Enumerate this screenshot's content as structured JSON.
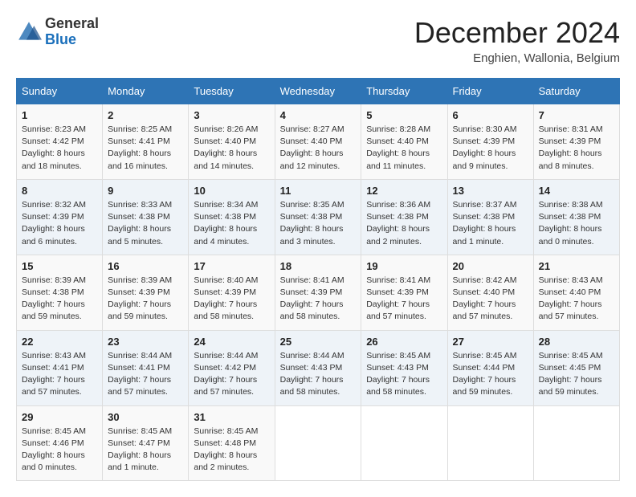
{
  "header": {
    "logo_general": "General",
    "logo_blue": "Blue",
    "month_title": "December 2024",
    "subtitle": "Enghien, Wallonia, Belgium"
  },
  "calendar": {
    "days_of_week": [
      "Sunday",
      "Monday",
      "Tuesday",
      "Wednesday",
      "Thursday",
      "Friday",
      "Saturday"
    ],
    "weeks": [
      [
        null,
        {
          "day": "2",
          "sunrise": "8:25 AM",
          "sunset": "4:41 PM",
          "daylight": "8 hours and 16 minutes."
        },
        {
          "day": "3",
          "sunrise": "8:26 AM",
          "sunset": "4:40 PM",
          "daylight": "8 hours and 14 minutes."
        },
        {
          "day": "4",
          "sunrise": "8:27 AM",
          "sunset": "4:40 PM",
          "daylight": "8 hours and 12 minutes."
        },
        {
          "day": "5",
          "sunrise": "8:28 AM",
          "sunset": "4:40 PM",
          "daylight": "8 hours and 11 minutes."
        },
        {
          "day": "6",
          "sunrise": "8:30 AM",
          "sunset": "4:39 PM",
          "daylight": "8 hours and 9 minutes."
        },
        {
          "day": "7",
          "sunrise": "8:31 AM",
          "sunset": "4:39 PM",
          "daylight": "8 hours and 8 minutes."
        }
      ],
      [
        {
          "day": "1",
          "sunrise": "8:23 AM",
          "sunset": "4:42 PM",
          "daylight": "8 hours and 18 minutes."
        },
        {
          "day": "8",
          "sunrise": "8:32 AM",
          "sunset": "4:39 PM",
          "daylight": "8 hours and 6 minutes."
        },
        {
          "day": "9",
          "sunrise": "8:33 AM",
          "sunset": "4:38 PM",
          "daylight": "8 hours and 5 minutes."
        },
        {
          "day": "10",
          "sunrise": "8:34 AM",
          "sunset": "4:38 PM",
          "daylight": "8 hours and 4 minutes."
        },
        {
          "day": "11",
          "sunrise": "8:35 AM",
          "sunset": "4:38 PM",
          "daylight": "8 hours and 3 minutes."
        },
        {
          "day": "12",
          "sunrise": "8:36 AM",
          "sunset": "4:38 PM",
          "daylight": "8 hours and 2 minutes."
        },
        {
          "day": "13",
          "sunrise": "8:37 AM",
          "sunset": "4:38 PM",
          "daylight": "8 hours and 1 minute."
        },
        {
          "day": "14",
          "sunrise": "8:38 AM",
          "sunset": "4:38 PM",
          "daylight": "8 hours and 0 minutes."
        }
      ],
      [
        {
          "day": "15",
          "sunrise": "8:39 AM",
          "sunset": "4:38 PM",
          "daylight": "7 hours and 59 minutes."
        },
        {
          "day": "16",
          "sunrise": "8:39 AM",
          "sunset": "4:39 PM",
          "daylight": "7 hours and 59 minutes."
        },
        {
          "day": "17",
          "sunrise": "8:40 AM",
          "sunset": "4:39 PM",
          "daylight": "7 hours and 58 minutes."
        },
        {
          "day": "18",
          "sunrise": "8:41 AM",
          "sunset": "4:39 PM",
          "daylight": "7 hours and 58 minutes."
        },
        {
          "day": "19",
          "sunrise": "8:41 AM",
          "sunset": "4:39 PM",
          "daylight": "7 hours and 57 minutes."
        },
        {
          "day": "20",
          "sunrise": "8:42 AM",
          "sunset": "4:40 PM",
          "daylight": "7 hours and 57 minutes."
        },
        {
          "day": "21",
          "sunrise": "8:43 AM",
          "sunset": "4:40 PM",
          "daylight": "7 hours and 57 minutes."
        }
      ],
      [
        {
          "day": "22",
          "sunrise": "8:43 AM",
          "sunset": "4:41 PM",
          "daylight": "7 hours and 57 minutes."
        },
        {
          "day": "23",
          "sunrise": "8:44 AM",
          "sunset": "4:41 PM",
          "daylight": "7 hours and 57 minutes."
        },
        {
          "day": "24",
          "sunrise": "8:44 AM",
          "sunset": "4:42 PM",
          "daylight": "7 hours and 57 minutes."
        },
        {
          "day": "25",
          "sunrise": "8:44 AM",
          "sunset": "4:43 PM",
          "daylight": "7 hours and 58 minutes."
        },
        {
          "day": "26",
          "sunrise": "8:45 AM",
          "sunset": "4:43 PM",
          "daylight": "7 hours and 58 minutes."
        },
        {
          "day": "27",
          "sunrise": "8:45 AM",
          "sunset": "4:44 PM",
          "daylight": "7 hours and 59 minutes."
        },
        {
          "day": "28",
          "sunrise": "8:45 AM",
          "sunset": "4:45 PM",
          "daylight": "7 hours and 59 minutes."
        }
      ],
      [
        {
          "day": "29",
          "sunrise": "8:45 AM",
          "sunset": "4:46 PM",
          "daylight": "8 hours and 0 minutes."
        },
        {
          "day": "30",
          "sunrise": "8:45 AM",
          "sunset": "4:47 PM",
          "daylight": "8 hours and 1 minute."
        },
        {
          "day": "31",
          "sunrise": "8:45 AM",
          "sunset": "4:48 PM",
          "daylight": "8 hours and 2 minutes."
        },
        null,
        null,
        null,
        null
      ]
    ]
  }
}
